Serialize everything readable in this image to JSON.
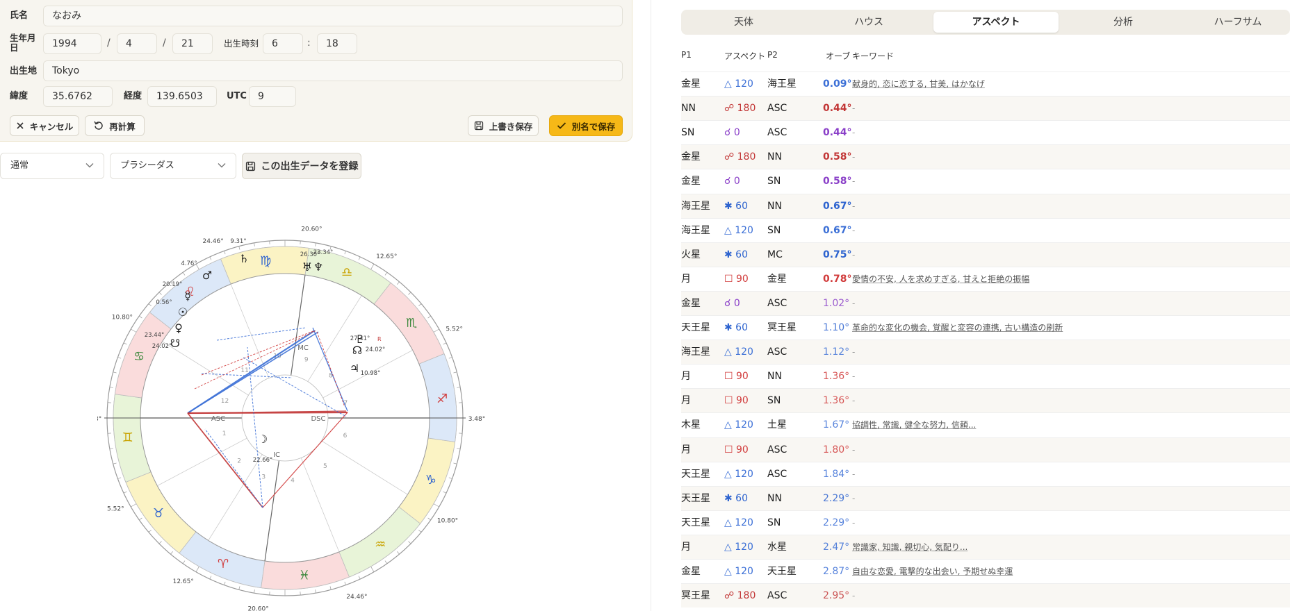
{
  "form": {
    "name_label": "氏名",
    "name_value": "なおみ",
    "birth_label": "生年月日",
    "year": "1994",
    "month": "4",
    "day": "21",
    "date_sep": "/",
    "time_label": "出生時刻",
    "hour": "6",
    "minute": "18",
    "time_sep": ":",
    "place_label": "出生地",
    "place_value": "Tokyo",
    "lat_label": "緯度",
    "lat_value": "35.6762",
    "lon_label": "経度",
    "lon_value": "139.6503",
    "utc_label": "UTC",
    "utc_value": "9",
    "cancel_label": "キャンセル",
    "recalc_label": "再計算",
    "overwrite_label": "上書き保存",
    "save_as_label": "別名で保存"
  },
  "controls": {
    "mode_select": "通常",
    "house_select": "プラシーダス",
    "register_label": "この出生データを登録"
  },
  "wheel": {
    "cusp_degrees": [
      "3.48°",
      "5.52°",
      "12.65°",
      "20.60°",
      "24.46°",
      "10.80°",
      "3.48°",
      "5.52°",
      "12.65°",
      "20.60°",
      "24.46°",
      "10.80°"
    ],
    "angle_labels": [
      "MC",
      "ASC",
      "DSC",
      "IC"
    ],
    "house_numbers": [
      "1",
      "2",
      "3",
      "4",
      "5",
      "6",
      "7",
      "8",
      "9",
      "10",
      "11",
      "12"
    ],
    "planet_degrees": [
      "9.31°",
      "4.76°",
      "20.19°",
      "0.56°",
      "23.44°",
      "24.02°",
      "26.30°",
      "23.34°",
      "27.41°",
      "24.02°",
      "10.98°",
      "22.66°"
    ],
    "retro_mark": "R",
    "zodiac_glyphs": [
      "♓",
      "♒",
      "♑",
      "♐",
      "♏",
      "♎",
      "♍",
      "♌",
      "♋",
      "♊",
      "♉",
      "♈"
    ],
    "planet_glyphs": [
      "♄",
      "♅",
      "♆",
      "♂",
      "☿",
      "☉",
      "♀",
      "☋",
      "♇",
      "☊",
      "♃",
      "☽"
    ]
  },
  "tabs": [
    "天体",
    "ハウス",
    "アスペクト",
    "分析",
    "ハーフサム"
  ],
  "active_tab": "アスペクト",
  "table": {
    "headers": [
      "P1",
      "アスペクト",
      "P2",
      "オーブ",
      "キーワード"
    ],
    "rows": [
      {
        "p1": "金星",
        "aspect": "△ 120",
        "p2": "海王星",
        "orb": "0.09°",
        "kw": "献身的, 恋に恋する, 甘美, はかなげ"
      },
      {
        "p1": "NN",
        "aspect": "☍ 180",
        "p2": "ASC",
        "orb": "0.44°",
        "kw": "-"
      },
      {
        "p1": "SN",
        "aspect": "☌ 0",
        "p2": "ASC",
        "orb": "0.44°",
        "kw": "-"
      },
      {
        "p1": "金星",
        "aspect": "☍ 180",
        "p2": "NN",
        "orb": "0.58°",
        "kw": "-"
      },
      {
        "p1": "金星",
        "aspect": "☌ 0",
        "p2": "SN",
        "orb": "0.58°",
        "kw": "-"
      },
      {
        "p1": "海王星",
        "aspect": "✱ 60",
        "p2": "NN",
        "orb": "0.67°",
        "kw": "-"
      },
      {
        "p1": "海王星",
        "aspect": "△ 120",
        "p2": "SN",
        "orb": "0.67°",
        "kw": "-"
      },
      {
        "p1": "火星",
        "aspect": "✱ 60",
        "p2": "MC",
        "orb": "0.75°",
        "kw": "-"
      },
      {
        "p1": "月",
        "aspect": "☐ 90",
        "p2": "金星",
        "orb": "0.78°",
        "kw": "愛情の不安, 人を求めすぎる, 甘えと拒絶の振幅"
      },
      {
        "p1": "金星",
        "aspect": "☌ 0",
        "p2": "ASC",
        "orb": "1.02°",
        "kw": "-"
      },
      {
        "p1": "天王星",
        "aspect": "✱ 60",
        "p2": "冥王星",
        "orb": "1.10°",
        "kw": "革命的な変化の機会, 覚醒と変容の連携, 古い構造の刷新"
      },
      {
        "p1": "海王星",
        "aspect": "△ 120",
        "p2": "ASC",
        "orb": "1.12°",
        "kw": "-"
      },
      {
        "p1": "月",
        "aspect": "☐ 90",
        "p2": "NN",
        "orb": "1.36°",
        "kw": "-"
      },
      {
        "p1": "月",
        "aspect": "☐ 90",
        "p2": "SN",
        "orb": "1.36°",
        "kw": "-"
      },
      {
        "p1": "木星",
        "aspect": "△ 120",
        "p2": "土星",
        "orb": "1.67°",
        "kw": "協調性, 常識, 健全な努力, 信頼..."
      },
      {
        "p1": "月",
        "aspect": "☐ 90",
        "p2": "ASC",
        "orb": "1.80°",
        "kw": "-"
      },
      {
        "p1": "天王星",
        "aspect": "△ 120",
        "p2": "ASC",
        "orb": "1.84°",
        "kw": "-"
      },
      {
        "p1": "天王星",
        "aspect": "✱ 60",
        "p2": "NN",
        "orb": "2.29°",
        "kw": "-"
      },
      {
        "p1": "天王星",
        "aspect": "△ 120",
        "p2": "SN",
        "orb": "2.29°",
        "kw": "-"
      },
      {
        "p1": "月",
        "aspect": "△ 120",
        "p2": "水星",
        "orb": "2.47°",
        "kw": "常識家, 知識, 親切心, 気配り..."
      },
      {
        "p1": "金星",
        "aspect": "△ 120",
        "p2": "天王星",
        "orb": "2.87°",
        "kw": "自由な恋愛, 電撃的な出会い, 予期せぬ幸運"
      },
      {
        "p1": "冥王星",
        "aspect": "☍ 180",
        "p2": "ASC",
        "orb": "2.95°",
        "kw": "-"
      }
    ]
  },
  "colors": {
    "trine": "#3b6fd6",
    "sextile": "#2d63cf",
    "square": "#d13b3b",
    "opposition": "#c23636",
    "conjunction": "#8a3fc8",
    "accent": "#f6b817"
  }
}
